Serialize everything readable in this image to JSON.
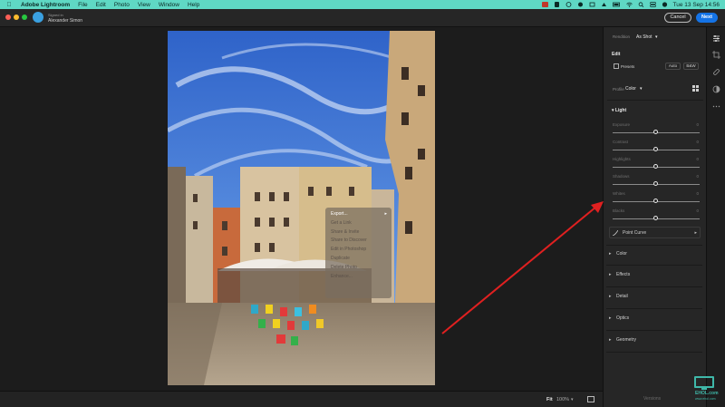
{
  "menubar": {
    "app_name": "Adobe Lightroom",
    "items": [
      "File",
      "Edit",
      "Photo",
      "View",
      "Window",
      "Help"
    ],
    "clock": "Tue 13 Sep  14:56"
  },
  "titlebar": {
    "signed_in_label": "Signed in",
    "user_name": "Alexander Simon",
    "cancel_label": "Cancel",
    "next_label": "Next"
  },
  "context_menu": {
    "items": [
      {
        "label": "Export...",
        "active": true
      },
      {
        "label": "Get a Link",
        "active": false
      },
      {
        "label": "Share & Invite",
        "active": false
      },
      {
        "label": "Share to Discover",
        "active": false
      },
      {
        "label": "Edit in Photoshop",
        "active": false
      },
      {
        "label": "Duplicate",
        "active": false
      },
      {
        "label": "Delete Photo",
        "active": false
      },
      {
        "label": "Enhance...",
        "active": false
      }
    ]
  },
  "bottombar": {
    "fit_label": "Fit",
    "zoom_value": "100%"
  },
  "panel": {
    "rendition_label": "Rendition",
    "rendition_value": "As Shot",
    "edit_title": "Edit",
    "presets_label": "Presets",
    "auto_label": "Auto",
    "bw_label": "B&W",
    "profile_label": "Profile",
    "profile_value": "Color",
    "light_title": "Light",
    "sliders": [
      {
        "label": "Exposure",
        "value": "0",
        "position": 0.5
      },
      {
        "label": "Contrast",
        "value": "0",
        "position": 0.5
      },
      {
        "label": "Highlights",
        "value": "0",
        "position": 0.5
      },
      {
        "label": "Shadows",
        "value": "0",
        "position": 0.5
      },
      {
        "label": "Whites",
        "value": "0",
        "position": 0.5
      },
      {
        "label": "Blacks",
        "value": "0",
        "position": 0.5
      }
    ],
    "point_curve_label": "Point Curve",
    "groups": [
      "Color",
      "Effects",
      "Detail",
      "Optics",
      "Geometry"
    ],
    "versions_label": "Versions"
  },
  "watermark": {
    "brand": "EHOL.com",
    "sub": "www.ehol.com"
  },
  "colors": {
    "menubar": "#5fd8c4",
    "accent": "#1473e6",
    "annotation_arrow": "#e02020"
  }
}
